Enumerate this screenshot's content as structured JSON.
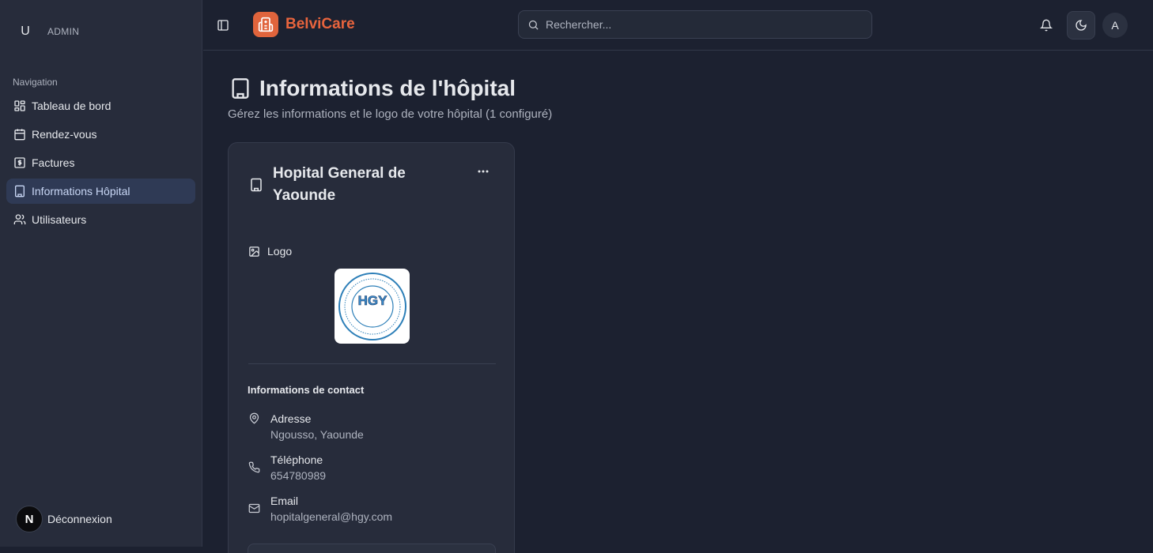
{
  "user": {
    "initial": "U",
    "role": "ADMIN"
  },
  "sidebar": {
    "heading": "Navigation",
    "items": [
      {
        "label": "Tableau de bord",
        "icon": "dashboard-icon"
      },
      {
        "label": "Rendez-vous",
        "icon": "calendar-icon"
      },
      {
        "label": "Factures",
        "icon": "invoice-icon"
      },
      {
        "label": "Informations Hôpital",
        "icon": "building-icon",
        "active": true
      },
      {
        "label": "Utilisateurs",
        "icon": "users-icon"
      }
    ],
    "logout": {
      "badge": "N",
      "label": "Déconnexion"
    }
  },
  "header": {
    "brand": "BelviCare",
    "search_placeholder": "Rechercher...",
    "avatar": "A"
  },
  "page": {
    "title": "Informations de l'hôpital",
    "subtitle": "Gérez les informations et le logo de votre hôpital (1 configuré)"
  },
  "hospital": {
    "name": "Hopital General de Yaounde",
    "logo_label": "Logo",
    "contact_heading": "Informations de contact",
    "address_label": "Adresse",
    "address": "Ngousso, Yaounde",
    "phone_label": "Téléphone",
    "phone": "654780989",
    "email_label": "Email",
    "email": "hopitalgeneral@hgy.com",
    "logo_text": "HGY"
  },
  "colors": {
    "brand": "#e0643c",
    "background": "#1c2130",
    "sidebar": "#272c3b",
    "active_nav": "#2f3a55"
  }
}
